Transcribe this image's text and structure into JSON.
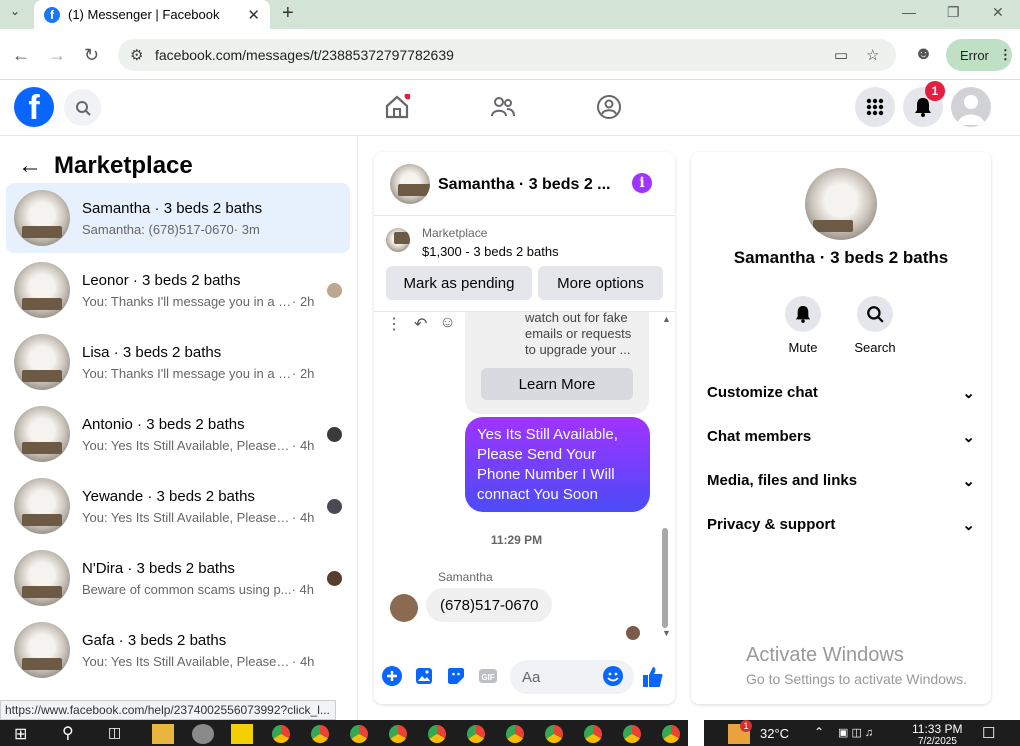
{
  "browser": {
    "tab_title": "(1) Messenger | Facebook",
    "url": "facebook.com/messages/t/23885372797782639",
    "profile_error": "Error"
  },
  "fb_header": {
    "logo_glyph": "f",
    "notifications_badge": "1"
  },
  "left_panel": {
    "title": "Marketplace",
    "conversations": [
      {
        "name": "Samantha · 3 beds 2 baths",
        "preview": "Samantha: (678)517-0670",
        "time": "· 3m"
      },
      {
        "name": "Leonor · 3 beds 2 baths",
        "preview": "You: Thanks I'll message you in a m...",
        "time": "· 2h"
      },
      {
        "name": "Lisa · 3 beds 2 baths",
        "preview": "You: Thanks I'll message you in a mo...",
        "time": "· 2h"
      },
      {
        "name": "Antonio · 3 beds 2 baths",
        "preview": "You: Yes Its Still Available, Please Se...",
        "time": "· 4h"
      },
      {
        "name": "Yewande · 3 beds 2 baths",
        "preview": "You: Yes Its Still Available, Please Se...",
        "time": "· 4h"
      },
      {
        "name": "N'Dira · 3 beds 2 baths",
        "preview": "Beware of common scams using p...",
        "time": "· 4h"
      },
      {
        "name": "Gafa · 3 beds 2 baths",
        "preview": "You: Yes Its Still Available, Please Send...",
        "time": "· 4h"
      }
    ]
  },
  "status_url": "https://www.facebook.com/help/2374002556073992?click_l...",
  "chat": {
    "title": "Samantha · 3 beds 2 ...",
    "marketplace_label": "Marketplace",
    "listing": "$1,300 - 3 beds 2 baths",
    "mark_pending": "Mark as pending",
    "more_options": "More options",
    "warning_text": "watch out for fake emails or requests to upgrade your ...",
    "learn_more": "Learn More",
    "sent_message": "Yes Its Still Available, Please Send Your Phone Number I Will connact You Soon",
    "timestamp": "11:29 PM",
    "sender_name": "Samantha",
    "received_message": "(678)517-0670",
    "composer_placeholder": "Aa"
  },
  "details": {
    "name": "Samantha · 3 beds 2 baths",
    "mute": "Mute",
    "search": "Search",
    "sections": [
      "Customize chat",
      "Chat members",
      "Media, files and links",
      "Privacy & support"
    ]
  },
  "watermark": {
    "line1": "Activate Windows",
    "line2": "Go to Settings to activate Windows."
  },
  "taskbar": {
    "temperature": "32°C",
    "time": "11:33 PM",
    "date": "7/2/2025",
    "badge": "1"
  }
}
